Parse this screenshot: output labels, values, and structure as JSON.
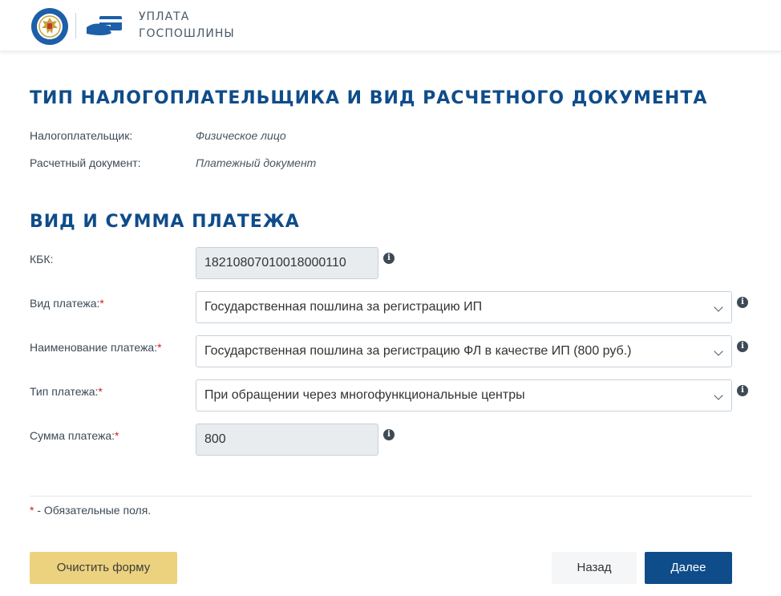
{
  "header": {
    "title_line1": "УПЛАТА",
    "title_line2": "ГОСПОШЛИНЫ"
  },
  "section1": {
    "heading": "ТИП НАЛОГОПЛАТЕЛЬЩИКА И ВИД РАСЧЕТНОГО ДОКУМЕНТА",
    "taxpayer_label": "Налогоплательщик:",
    "taxpayer_value": "Физическое лицо",
    "document_label": "Расчетный документ:",
    "document_value": "Платежный документ"
  },
  "section2": {
    "heading": "ВИД И СУММА ПЛАТЕЖА",
    "kbk_label": "КБК:",
    "kbk_value": "18210807010018000110",
    "payment_kind_label": "Вид платежа:",
    "payment_kind_value": "Государственная пошлина за регистрацию ИП",
    "payment_name_label": "Наименование платежа:",
    "payment_name_value": "Государственная пошлина за регистрацию ФЛ в качестве ИП (800 руб.)",
    "payment_type_label": "Тип платежа:",
    "payment_type_value": "При обращении через многофункциональные центры",
    "amount_label": "Сумма платежа:",
    "amount_value": "800",
    "required_mark": "*",
    "info_glyph": "i"
  },
  "footer": {
    "required_star": "*",
    "required_note": " - Обязательные поля.",
    "clear_button": "Очистить форму",
    "back_button": "Назад",
    "next_button": "Далее"
  },
  "colors": {
    "brand_blue": "#0f4c8a",
    "clear_button_bg": "#ecd27e",
    "required_red": "#d21f1f"
  }
}
